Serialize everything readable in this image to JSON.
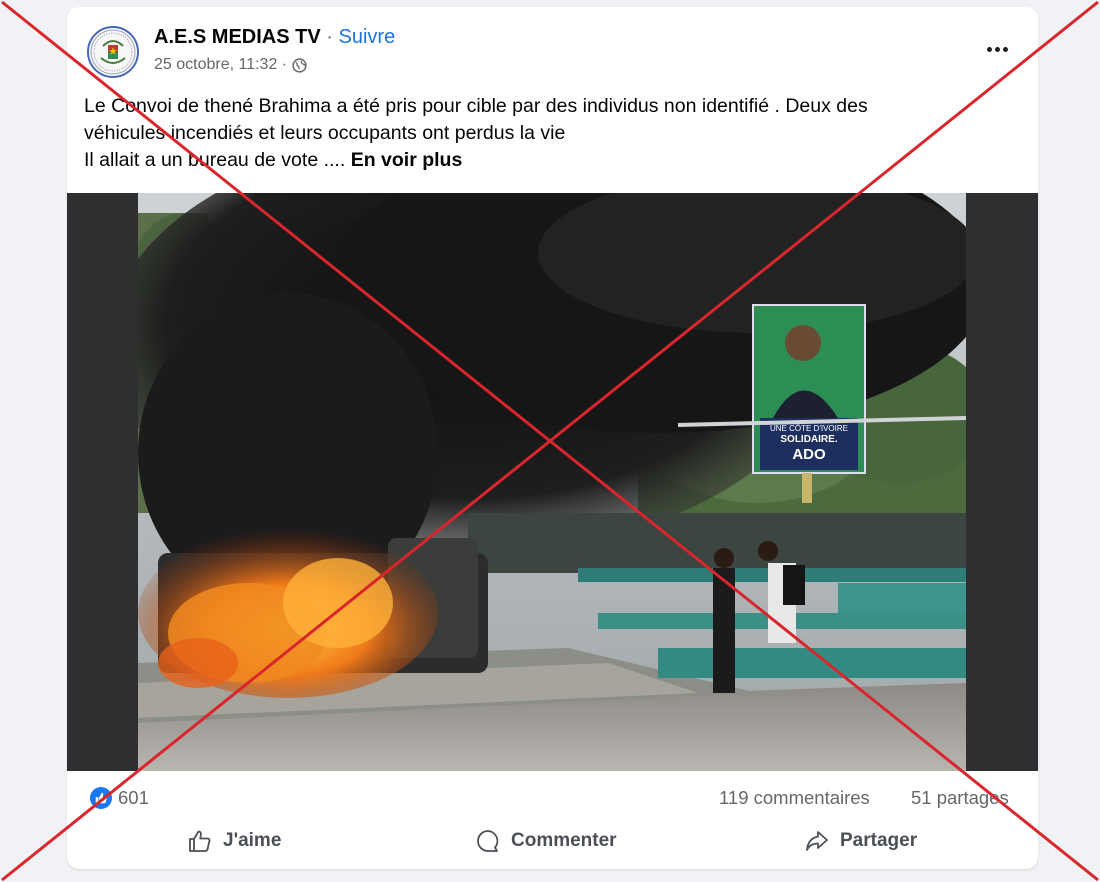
{
  "post": {
    "page_name": "A.E.S MEDIAS TV",
    "separator": "·",
    "follow_label": "Suivre",
    "date": "25 octobre, 11:32 ·",
    "privacy_icon": "globe-icon",
    "more_icon": "more-options-icon",
    "text_lines": [
      "Le Convoi de thené Brahima a été pris pour cible par des individus non identifié .  Deux des",
      "véhicules incendiés et leurs occupants ont perdus la vie",
      "Il allait a un bureau de vote ...."
    ],
    "see_more": "En voir plus",
    "photo": {
      "billboard_line1": "UNE CÔTE D'IVOIRE",
      "billboard_line2": "SOLIDAIRE.",
      "billboard_line3": "ADO"
    }
  },
  "stats": {
    "reaction_icon": "like-reaction-icon",
    "likes": "601",
    "comments": "119 commentaires",
    "shares": "51 partages"
  },
  "actions": {
    "like": "J'aime",
    "comment": "Commenter",
    "share": "Partager"
  },
  "colors": {
    "link_blue": "#1b74e4",
    "reaction_blue": "#1877f2",
    "cross_red": "#d9262c",
    "background": "#f0f2f5"
  }
}
